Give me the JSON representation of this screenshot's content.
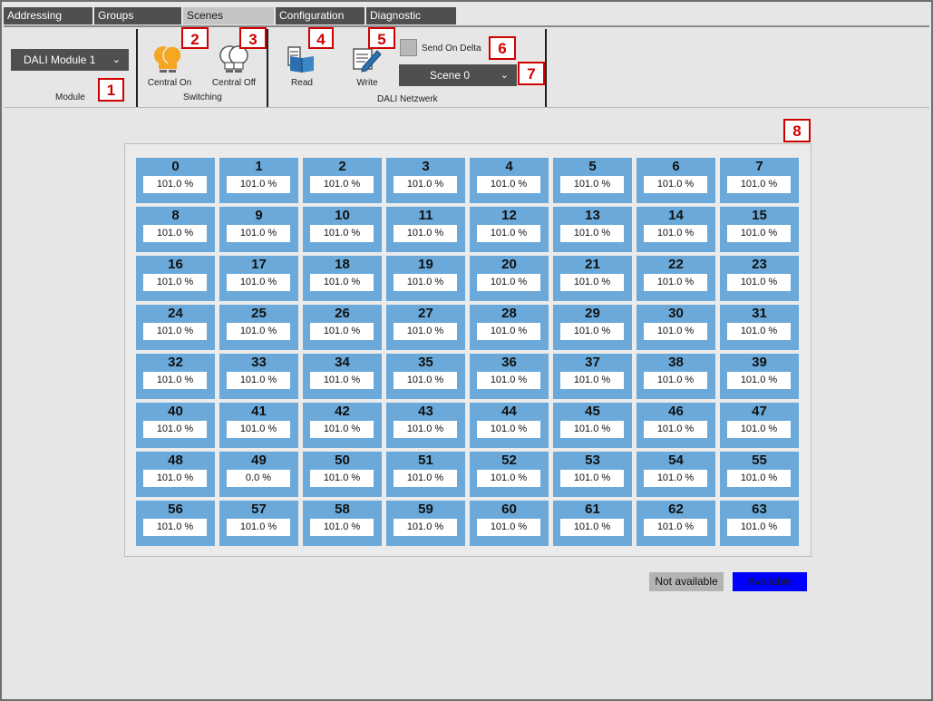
{
  "tabs": [
    {
      "label": "Addressing",
      "active": false
    },
    {
      "label": "Groups",
      "active": false
    },
    {
      "label": "Scenes",
      "active": true
    },
    {
      "label": "Configuration",
      "active": false
    },
    {
      "label": "Diagnostic",
      "active": false
    }
  ],
  "ribbon": {
    "module": {
      "selected": "DALI Module 1",
      "group_label": "Module"
    },
    "switching": {
      "central_on": "Central On",
      "central_off": "Central Off",
      "group_label": "Switching"
    },
    "network": {
      "read": "Read",
      "write": "Write",
      "send_on_delta": "Send On Delta",
      "scene_selected": "Scene 0",
      "group_label": "DALI Netzwerk"
    }
  },
  "markers": [
    "1",
    "2",
    "3",
    "4",
    "5",
    "6",
    "7",
    "8"
  ],
  "devices": [
    {
      "address": "0",
      "value": "101.0 %"
    },
    {
      "address": "1",
      "value": "101.0 %"
    },
    {
      "address": "2",
      "value": "101.0 %"
    },
    {
      "address": "3",
      "value": "101.0 %"
    },
    {
      "address": "4",
      "value": "101.0 %"
    },
    {
      "address": "5",
      "value": "101.0 %"
    },
    {
      "address": "6",
      "value": "101.0 %"
    },
    {
      "address": "7",
      "value": "101.0 %"
    },
    {
      "address": "8",
      "value": "101.0 %"
    },
    {
      "address": "9",
      "value": "101.0 %"
    },
    {
      "address": "10",
      "value": "101.0 %"
    },
    {
      "address": "11",
      "value": "101.0 %"
    },
    {
      "address": "12",
      "value": "101.0 %"
    },
    {
      "address": "13",
      "value": "101.0 %"
    },
    {
      "address": "14",
      "value": "101.0 %"
    },
    {
      "address": "15",
      "value": "101.0 %"
    },
    {
      "address": "16",
      "value": "101.0 %"
    },
    {
      "address": "17",
      "value": "101.0 %"
    },
    {
      "address": "18",
      "value": "101.0 %"
    },
    {
      "address": "19",
      "value": "101.0 %"
    },
    {
      "address": "20",
      "value": "101.0 %"
    },
    {
      "address": "21",
      "value": "101.0 %"
    },
    {
      "address": "22",
      "value": "101.0 %"
    },
    {
      "address": "23",
      "value": "101.0 %"
    },
    {
      "address": "24",
      "value": "101.0 %"
    },
    {
      "address": "25",
      "value": "101.0 %"
    },
    {
      "address": "26",
      "value": "101.0 %"
    },
    {
      "address": "27",
      "value": "101.0 %"
    },
    {
      "address": "28",
      "value": "101.0 %"
    },
    {
      "address": "29",
      "value": "101.0 %"
    },
    {
      "address": "30",
      "value": "101.0 %"
    },
    {
      "address": "31",
      "value": "101.0 %"
    },
    {
      "address": "32",
      "value": "101.0 %"
    },
    {
      "address": "33",
      "value": "101.0 %"
    },
    {
      "address": "34",
      "value": "101.0 %"
    },
    {
      "address": "35",
      "value": "101.0 %"
    },
    {
      "address": "36",
      "value": "101.0 %"
    },
    {
      "address": "37",
      "value": "101.0 %"
    },
    {
      "address": "38",
      "value": "101.0 %"
    },
    {
      "address": "39",
      "value": "101.0 %"
    },
    {
      "address": "40",
      "value": "101.0 %"
    },
    {
      "address": "41",
      "value": "101.0 %"
    },
    {
      "address": "42",
      "value": "101.0 %"
    },
    {
      "address": "43",
      "value": "101.0 %"
    },
    {
      "address": "44",
      "value": "101.0 %"
    },
    {
      "address": "45",
      "value": "101.0 %"
    },
    {
      "address": "46",
      "value": "101.0 %"
    },
    {
      "address": "47",
      "value": "101.0 %"
    },
    {
      "address": "48",
      "value": "101.0 %"
    },
    {
      "address": "49",
      "value": "0.0 %"
    },
    {
      "address": "50",
      "value": "101.0 %"
    },
    {
      "address": "51",
      "value": "101.0 %"
    },
    {
      "address": "52",
      "value": "101.0 %"
    },
    {
      "address": "53",
      "value": "101.0 %"
    },
    {
      "address": "54",
      "value": "101.0 %"
    },
    {
      "address": "55",
      "value": "101.0 %"
    },
    {
      "address": "56",
      "value": "101.0 %"
    },
    {
      "address": "57",
      "value": "101.0 %"
    },
    {
      "address": "58",
      "value": "101.0 %"
    },
    {
      "address": "59",
      "value": "101.0 %"
    },
    {
      "address": "60",
      "value": "101.0 %"
    },
    {
      "address": "61",
      "value": "101.0 %"
    },
    {
      "address": "62",
      "value": "101.0 %"
    },
    {
      "address": "63",
      "value": "101.0 %"
    }
  ],
  "legend": {
    "not_available": {
      "label": "Not available",
      "color": "#b3b3b3"
    },
    "available": {
      "label": "Available",
      "color": "#0000ff"
    }
  },
  "colors": {
    "cell": "#6aa9d9",
    "marker": "#d00000",
    "bulb": "#f5a623"
  }
}
